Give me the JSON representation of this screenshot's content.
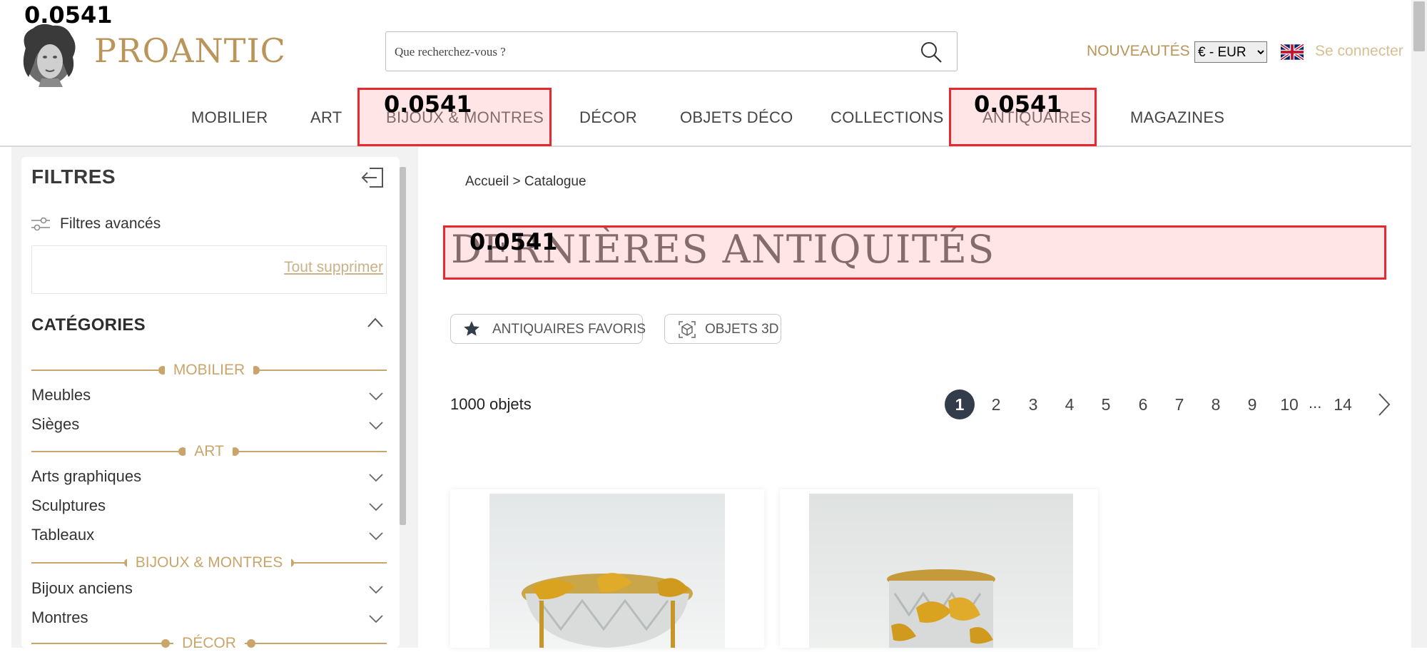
{
  "overlay": {
    "score_label": "0.0541"
  },
  "header": {
    "logo_text": "PROANTIC",
    "search_placeholder": "Que recherchez-vous ?",
    "nouveautes": "NOUVEAUTÉS",
    "currency": "€ - EUR",
    "login": "Se connecter"
  },
  "nav": [
    "MOBILIER",
    "ART",
    "BIJOUX & MONTRES",
    "DÉCOR",
    "OBJETS DÉCO",
    "COLLECTIONS",
    "ANTIQUAIRES",
    "MAGAZINES"
  ],
  "sidebar": {
    "title": "FILTRES",
    "advanced": "Filtres avancés",
    "clear_all": "Tout supprimer",
    "categories_title": "CATÉGORIES",
    "groups": {
      "mobilier": {
        "label": "MOBILIER",
        "items": [
          "Meubles",
          "Sièges"
        ]
      },
      "art": {
        "label": "ART",
        "items": [
          "Arts graphiques",
          "Sculptures",
          "Tableaux"
        ]
      },
      "bijoux": {
        "label": "BIJOUX & MONTRES",
        "items": [
          "Bijoux anciens",
          "Montres"
        ]
      },
      "decor": {
        "label": "DÉCOR"
      }
    }
  },
  "main": {
    "breadcrumb": {
      "home": "Accueil",
      "sep": ">",
      "current": "Catalogue"
    },
    "title": "DERNIÈRES ANTIQUITÉS",
    "chips": {
      "favorites": "ANTIQUAIRES FAVORIS",
      "objects3d": "OBJETS 3D"
    },
    "count": "1000 objets",
    "pagination": {
      "pages": [
        "1",
        "2",
        "3",
        "4",
        "5",
        "6",
        "7",
        "8",
        "9",
        "10"
      ],
      "ellipsis": "...",
      "last": "14",
      "current": "1"
    }
  },
  "colors": {
    "gold": "#b9955a",
    "accent_dark": "#333c4a",
    "highlight": "#e8282f"
  }
}
